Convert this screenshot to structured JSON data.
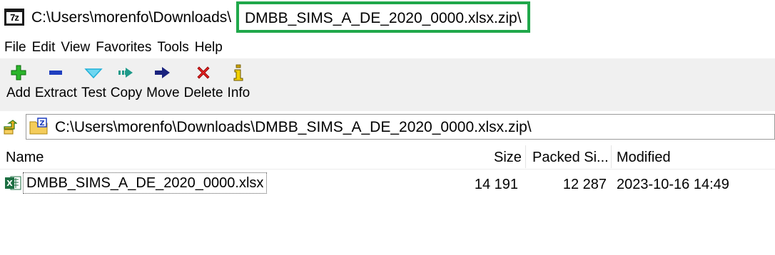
{
  "titlebar": {
    "app_icon_text": "7z",
    "path_prefix": "C:\\Users\\morenfo\\Downloads\\",
    "highlighted_part": "DMBB_SIMS_A_DE_2020_0000.xlsx.zip\\",
    "highlight_color": "#20a84b"
  },
  "menu": {
    "items": [
      "File",
      "Edit",
      "View",
      "Favorites",
      "Tools",
      "Help"
    ]
  },
  "toolbar": {
    "buttons": [
      {
        "label": "Add",
        "icon": "plus-icon",
        "color": "#2bb52b"
      },
      {
        "label": "Extract",
        "icon": "minus-icon",
        "color": "#1f3fbf"
      },
      {
        "label": "Test",
        "icon": "check-chevron-icon",
        "color": "#1fb0d8"
      },
      {
        "label": "Copy",
        "icon": "copy-arrow-icon",
        "color": "#1f9a8a"
      },
      {
        "label": "Move",
        "icon": "move-arrow-icon",
        "color": "#1a237e"
      },
      {
        "label": "Delete",
        "icon": "delete-x-icon",
        "color": "#e02020"
      },
      {
        "label": "Info",
        "icon": "info-icon",
        "color": "#c8a000"
      }
    ]
  },
  "address": {
    "path": "C:\\Users\\morenfo\\Downloads\\DMBB_SIMS_A_DE_2020_0000.xlsx.zip\\"
  },
  "list": {
    "columns": {
      "name": "Name",
      "size": "Size",
      "packed": "Packed Si...",
      "modified": "Modified"
    },
    "rows": [
      {
        "name": "DMBB_SIMS_A_DE_2020_0000.xlsx",
        "size": "14 191",
        "packed": "12 287",
        "modified": "2023-10-16 14:49"
      }
    ]
  }
}
